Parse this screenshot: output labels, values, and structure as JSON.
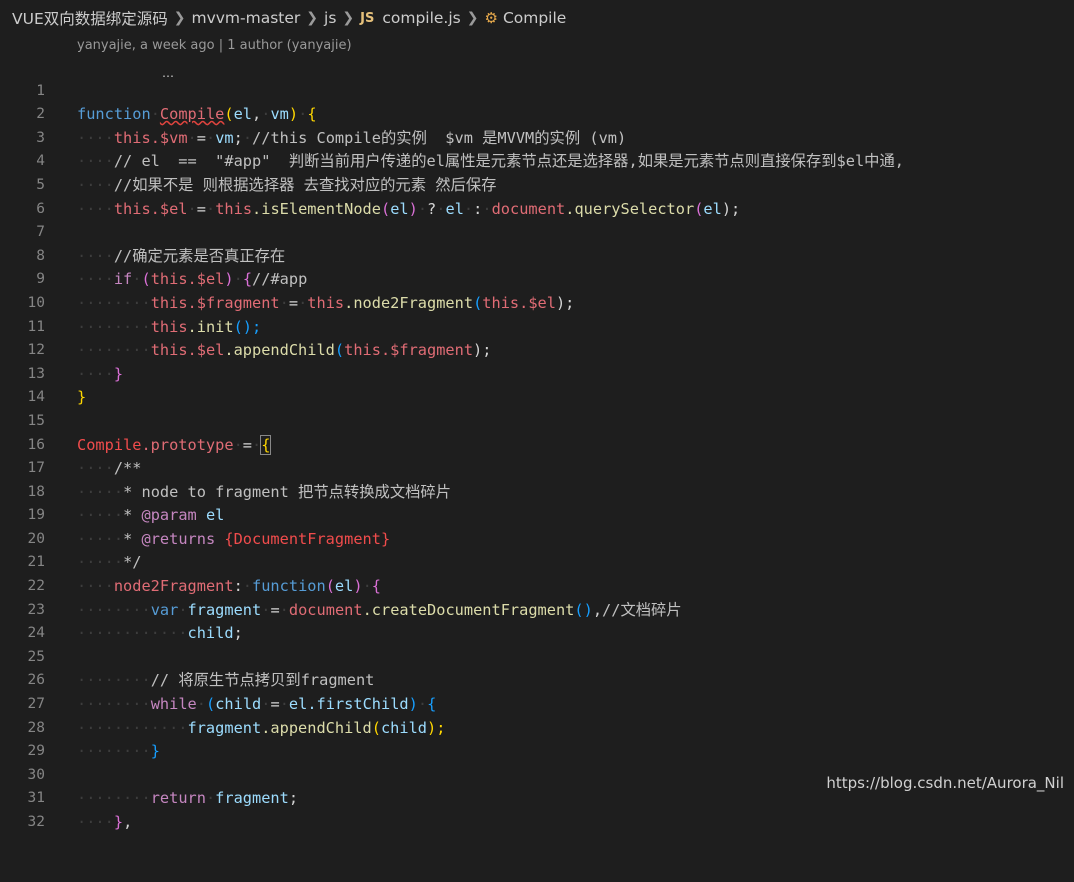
{
  "breadcrumb": {
    "items": [
      "VUE双向数据绑定源码",
      "mvvm-master",
      "js"
    ],
    "file_badge": "JS",
    "file": "compile.js",
    "symbol": "Compile",
    "symbol_icon": "class-symbol-icon"
  },
  "codelens": "yanyajie, a week ago | 1 author (yanyajie)",
  "line_numbers": [
    "1",
    "2",
    "3",
    "4",
    "5",
    "6",
    "7",
    "8",
    "9",
    "10",
    "11",
    "12",
    "13",
    "14",
    "15",
    "16",
    "17",
    "18",
    "19",
    "20",
    "21",
    "22",
    "23",
    "24",
    "25",
    "26",
    "27",
    "28",
    "29",
    "30",
    "31",
    "32"
  ],
  "code": {
    "l1": [
      "function",
      "Compile",
      "(",
      "el",
      ",",
      "vm",
      ")",
      "{"
    ],
    "l2": [
      "this",
      ".$vm",
      "=",
      "vm",
      ";",
      "//this Compile的实例  $vm 是MVVM的实例 (vm)"
    ],
    "l3": [
      "// el  ==  \"#app\"  判断当前用户传递的el属性是元素节点还是选择器,如果是元素节点则直接保存到$el中通,"
    ],
    "l4": [
      "//如果不是 则根据选择器 去查找对应的元素 然后保存"
    ],
    "l5": [
      "this",
      ".isElementNode",
      "this.$el",
      "=",
      "(",
      "el",
      ")",
      "?",
      "el",
      ":",
      "document",
      ".querySelector",
      "(",
      "el",
      ");"
    ],
    "l7": [
      "//确定元素是否真正存在"
    ],
    "l8": [
      "if",
      "(",
      "this.$el",
      ")",
      "{",
      "//#app"
    ],
    "l9": [
      "this.$fragment",
      "=",
      "this",
      ".node2Fragment",
      "(",
      "this.$el",
      ");"
    ],
    "l10": [
      "this",
      ".init",
      "();"
    ],
    "l11": [
      "this.$el",
      ".appendChild",
      "(",
      "this.$fragment",
      ");"
    ],
    "l12": [
      "}"
    ],
    "l13": [
      "}"
    ],
    "l15": [
      "Compile",
      ".prototype",
      "=",
      "{"
    ],
    "l16": [
      "/**"
    ],
    "l17": [
      "* node to fragment 把节点转换成文档碎片"
    ],
    "l18": [
      "* ",
      "@param",
      " el"
    ],
    "l19": [
      "* ",
      "@returns",
      " {DocumentFragment}"
    ],
    "l20": [
      "*/"
    ],
    "l21": [
      "node2Fragment",
      ":",
      "function",
      "(",
      "el",
      ")",
      "{"
    ],
    "l22": [
      "var",
      "fragment",
      "=",
      "document",
      ".createDocumentFragment",
      "()",
      ",",
      "//文档碎片"
    ],
    "l23": [
      "child",
      ";"
    ],
    "l25": [
      "// 将原生节点拷贝到fragment"
    ],
    "l26": [
      "while",
      "(",
      "child",
      "=",
      "el",
      ".firstChild",
      ")",
      "{"
    ],
    "l27": [
      "fragment",
      ".appendChild",
      "(",
      "child",
      ");"
    ],
    "l28": [
      "}"
    ],
    "l30": [
      "return",
      "fragment",
      ";"
    ],
    "l31": [
      "}",
      ","
    ]
  },
  "watermark": "https://blog.csdn.net/Aurora_Nil"
}
